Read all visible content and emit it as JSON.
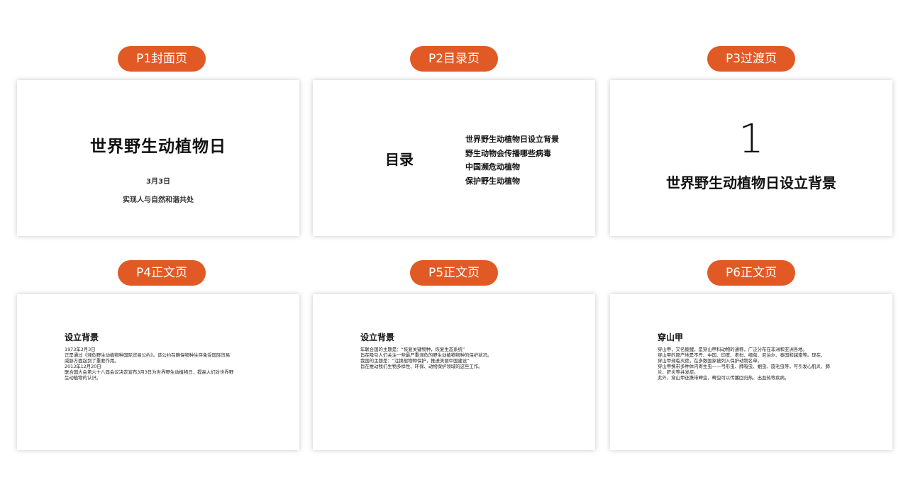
{
  "slides": [
    {
      "label": "P1封面页",
      "cover": {
        "title": "世界野生动植物日",
        "date": "3月3日",
        "subtitle": "实现人与自然和谐共处"
      }
    },
    {
      "label": "P2目录页",
      "toc": {
        "title": "目录",
        "items": [
          "世界野生动植物日设立背景",
          "野生动物会传播哪些病毒",
          "中国濒危动植物",
          "保护野生动植物"
        ]
      }
    },
    {
      "label": "P3过渡页",
      "transition": {
        "number": "1",
        "title": "世界野生动植物日设立背景"
      }
    },
    {
      "label": "P4正文页",
      "body": {
        "title": "设立背景",
        "lines": [
          "1973年3月3日",
          "正是通过《濒危野生动植物种国际贸易公约》。该公约在确保物种生存免受国际贸易",
          "威胁方面起到了重要作用。",
          "2013年12月20日",
          "联合国大会第六十八届会议决定宣布3月3日为世界野生动植物日，提高人们对世界野",
          "生动植物的认识。"
        ]
      }
    },
    {
      "label": "P5正文页",
      "body": {
        "title": "设立背景",
        "lines": [
          "年联合国的主题是：“恢复关键物种，恢复生态系统”",
          "旨在吸引人们关注一些最严重濒危的野生动植物物种的保护状况。",
          "我国的主题是：“注换般物种保护，推进美丽中国建设”",
          "旨在推动我们生物多样性、环保、动物保护领域的这些工作。"
        ]
      }
    },
    {
      "label": "P6正文页",
      "body": {
        "title": "穿山甲",
        "lines": [
          "穿山甲，又名鲮鲤，是穿山甲科动物的通称，广泛分布在非洲和亚洲各地。",
          "穿山甲的原产地是不丹、中国、印度、老挝、缅甸、尼泊尔、泰国和越南等。现在，",
          "穿山甲濒临灭绝，在多数国家被列入保护动物名单。",
          "穿山甲携带多种体内寄生虫——弓形虫、肺吸虫、蛔虫、旋毛虫等。可引发心肌炎、肺",
          "炎、肝炎等并发症。",
          "此外，穿山甲还携带蜱虫，蜱虫可以传播回归热、出血热等疾病。"
        ]
      }
    }
  ],
  "colors": {
    "accent": "#e15a25",
    "card_background": "#ffffff",
    "text": "#111111"
  }
}
